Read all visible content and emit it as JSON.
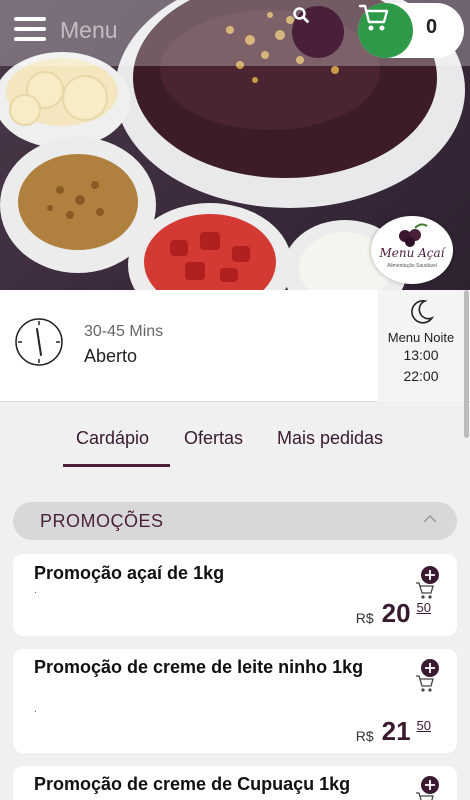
{
  "header": {
    "menu_label": "Menu",
    "cart_count": "0"
  },
  "logo": {
    "title": "Menu Açaí",
    "subtitle": "Alimentação Saudável"
  },
  "info": {
    "delivery_time": "30-45 Mins",
    "status": "Aberto",
    "hours_title": "Menu Noite",
    "open_time": "13:00",
    "close_time": "22:00"
  },
  "tabs": [
    {
      "label": "Cardápio",
      "active": true
    },
    {
      "label": "Ofertas",
      "active": false
    },
    {
      "label": "Mais pedidas",
      "active": false
    }
  ],
  "section": {
    "title": "PROMOÇÕES"
  },
  "products": [
    {
      "name": "Promoção açaí de 1kg",
      "desc": ".",
      "currency": "R$",
      "price_int": "20",
      "price_cents": "50"
    },
    {
      "name": "Promoção de creme de leite ninho 1kg",
      "desc": ".",
      "currency": "R$",
      "price_int": "21",
      "price_cents": "50"
    },
    {
      "name": "Promoção de creme de Cupuaçu 1kg",
      "desc": ".",
      "currency": "R$",
      "price_int": "",
      "price_cents": ""
    }
  ],
  "colors": {
    "brand": "#4a1f3a",
    "cart_green": "#2e9a48",
    "section_bg": "#d8d8d8"
  }
}
